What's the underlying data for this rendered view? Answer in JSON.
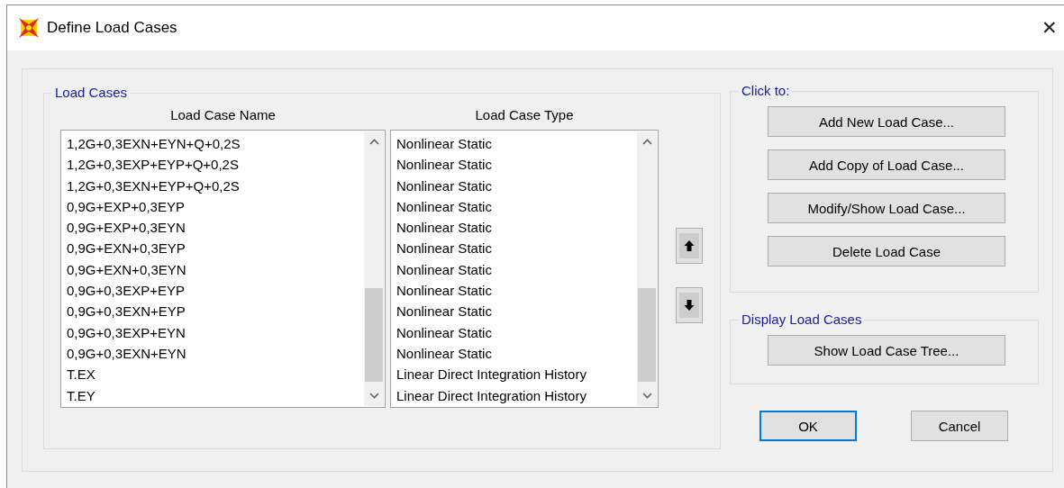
{
  "window": {
    "title": "Define Load Cases",
    "close": "✕"
  },
  "load_cases": {
    "label": "Load Cases",
    "columns": [
      "Load Case Name",
      "Load Case Type"
    ],
    "rows": [
      {
        "name": "1,2G+0,3EXN+EYN+Q+0,2S",
        "type": "Nonlinear Static"
      },
      {
        "name": "1,2G+0,3EXP+EYP+Q+0,2S",
        "type": "Nonlinear Static"
      },
      {
        "name": "1,2G+0,3EXN+EYP+Q+0,2S",
        "type": "Nonlinear Static"
      },
      {
        "name": "0,9G+EXP+0,3EYP",
        "type": "Nonlinear Static"
      },
      {
        "name": "0,9G+EXP+0,3EYN",
        "type": "Nonlinear Static"
      },
      {
        "name": "0,9G+EXN+0,3EYP",
        "type": "Nonlinear Static"
      },
      {
        "name": "0,9G+EXN+0,3EYN",
        "type": "Nonlinear Static"
      },
      {
        "name": "0,9G+0,3EXP+EYP",
        "type": "Nonlinear Static"
      },
      {
        "name": "0,9G+0,3EXN+EYP",
        "type": "Nonlinear Static"
      },
      {
        "name": "0,9G+0,3EXP+EYN",
        "type": "Nonlinear Static"
      },
      {
        "name": "0,9G+0,3EXN+EYN",
        "type": "Nonlinear Static"
      },
      {
        "name": "T.EX",
        "type": "Linear Direct Integration History"
      },
      {
        "name": "T.EY",
        "type": "Linear Direct Integration History"
      }
    ]
  },
  "click_to": {
    "label": "Click to:",
    "buttons": [
      "Add New Load Case...",
      "Add Copy of Load Case...",
      "Modify/Show Load Case...",
      "Delete Load Case"
    ]
  },
  "display": {
    "label": "Display Load Cases",
    "buttons": [
      "Show Load Case Tree..."
    ]
  },
  "dialog_buttons": [
    {
      "label": "OK",
      "default": true
    },
    {
      "label": "Cancel",
      "default": false
    }
  ]
}
